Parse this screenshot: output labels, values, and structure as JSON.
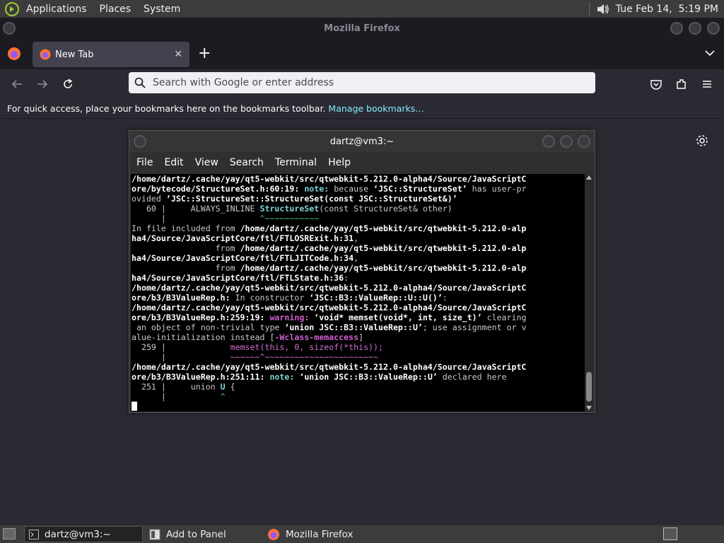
{
  "top_panel": {
    "menus": [
      "Applications",
      "Places",
      "System"
    ],
    "clock": "Tue Feb 14,  5:19 PM"
  },
  "firefox": {
    "window_title": "Mozilla Firefox",
    "tab_title": "New Tab",
    "urlbar_placeholder": "Search with Google or enter address",
    "bookmarks_message": "For quick access, place your bookmarks here on the bookmarks toolbar.",
    "bookmarks_link": "Manage bookmarks…"
  },
  "terminal": {
    "title": "dartz@vm3:~",
    "menus": [
      "File",
      "Edit",
      "View",
      "Search",
      "Terminal",
      "Help"
    ],
    "lines": [
      [
        {
          "t": "/home/dartz/.cache/yay/qt5-webkit/src/qtwebkit-5.212.0-alpha4/Source/JavaScriptC",
          "c": "b"
        }
      ],
      [
        {
          "t": "ore/bytecode/StructureSet.h:60:19: ",
          "c": "b"
        },
        {
          "t": "note: ",
          "c": "g"
        },
        {
          "t": "because ",
          "c": "w"
        },
        {
          "t": "‘JSC::StructureSet’",
          "c": "b"
        },
        {
          "t": " has user-pr",
          "c": "w"
        }
      ],
      [
        {
          "t": "ovided ",
          "c": "w"
        },
        {
          "t": "‘JSC::StructureSet::StructureSet(const JSC::StructureSet&)’",
          "c": "b"
        }
      ],
      [
        {
          "t": "   60 |     ALWAYS_INLINE ",
          "c": "w"
        },
        {
          "t": "StructureSet",
          "c": "g"
        },
        {
          "t": "(const StructureSet& other)",
          "c": "w"
        }
      ],
      [
        {
          "t": "      |                   ",
          "c": "w"
        },
        {
          "t": "^~~~~~~~~~~~",
          "c": "gn"
        }
      ],
      [
        {
          "t": "In file included from ",
          "c": "w"
        },
        {
          "t": "/home/dartz/.cache/yay/qt5-webkit/src/qtwebkit-5.212.0-alp",
          "c": "b"
        }
      ],
      [
        {
          "t": "ha4/Source/JavaScriptCore/ftl/FTLOSRExit.h:31",
          "c": "b"
        },
        {
          "t": ",",
          "c": "w"
        }
      ],
      [
        {
          "t": "                 from ",
          "c": "w"
        },
        {
          "t": "/home/dartz/.cache/yay/qt5-webkit/src/qtwebkit-5.212.0-alp",
          "c": "b"
        }
      ],
      [
        {
          "t": "ha4/Source/JavaScriptCore/ftl/FTLJITCode.h:34",
          "c": "b"
        },
        {
          "t": ",",
          "c": "w"
        }
      ],
      [
        {
          "t": "                 from ",
          "c": "w"
        },
        {
          "t": "/home/dartz/.cache/yay/qt5-webkit/src/qtwebkit-5.212.0-alp",
          "c": "b"
        }
      ],
      [
        {
          "t": "ha4/Source/JavaScriptCore/ftl/FTLState.h:36",
          "c": "b"
        },
        {
          "t": ":",
          "c": "w"
        }
      ],
      [
        {
          "t": "/home/dartz/.cache/yay/qt5-webkit/src/qtwebkit-5.212.0-alpha4/Source/JavaScriptC",
          "c": "b"
        }
      ],
      [
        {
          "t": "ore/b3/B3ValueRep.h:",
          "c": "b"
        },
        {
          "t": " In constructor ",
          "c": "w"
        },
        {
          "t": "‘JSC::B3::ValueRep::U::U()’",
          "c": "b"
        },
        {
          "t": ":",
          "c": "w"
        }
      ],
      [
        {
          "t": "/home/dartz/.cache/yay/qt5-webkit/src/qtwebkit-5.212.0-alpha4/Source/JavaScriptC",
          "c": "b"
        }
      ],
      [
        {
          "t": "ore/b3/B3ValueRep.h:259:19: ",
          "c": "b"
        },
        {
          "t": "warning: ",
          "c": "m"
        },
        {
          "t": "‘void* memset(void*, int, size_t)’",
          "c": "b"
        },
        {
          "t": " clearing",
          "c": "w"
        }
      ],
      [
        {
          "t": " an object of non-trivial type ",
          "c": "w"
        },
        {
          "t": "‘union JSC::B3::ValueRep::U’",
          "c": "b"
        },
        {
          "t": "; use assignment or v",
          "c": "w"
        }
      ],
      [
        {
          "t": "alue-initialization instead [",
          "c": "w"
        },
        {
          "t": "-Wclass-memaccess",
          "c": "m"
        },
        {
          "t": "]",
          "c": "w"
        }
      ],
      [
        {
          "t": "  259 |             ",
          "c": "w"
        },
        {
          "t": "memset(this, 0, sizeof(*this));",
          "c": "mp"
        }
      ],
      [
        {
          "t": "      |             ",
          "c": "w"
        },
        {
          "t": "~~~~~~^~~~~~~~~~~~~~~~~~~~~~~~",
          "c": "mp"
        }
      ],
      [
        {
          "t": "/home/dartz/.cache/yay/qt5-webkit/src/qtwebkit-5.212.0-alpha4/Source/JavaScriptC",
          "c": "b"
        }
      ],
      [
        {
          "t": "ore/b3/B3ValueRep.h:251:11: ",
          "c": "b"
        },
        {
          "t": "note: ",
          "c": "g"
        },
        {
          "t": "‘union JSC::B3::ValueRep::U’",
          "c": "b"
        },
        {
          "t": " declared here",
          "c": "w"
        }
      ],
      [
        {
          "t": "  251 |     union ",
          "c": "w"
        },
        {
          "t": "U",
          "c": "g"
        },
        {
          "t": " {",
          "c": "w"
        }
      ],
      [
        {
          "t": "      |           ",
          "c": "w"
        },
        {
          "t": "^",
          "c": "gn"
        }
      ]
    ]
  },
  "bottom_panel": {
    "tasks": [
      "dartz@vm3:~",
      "Add to Panel",
      "Mozilla Firefox"
    ]
  }
}
